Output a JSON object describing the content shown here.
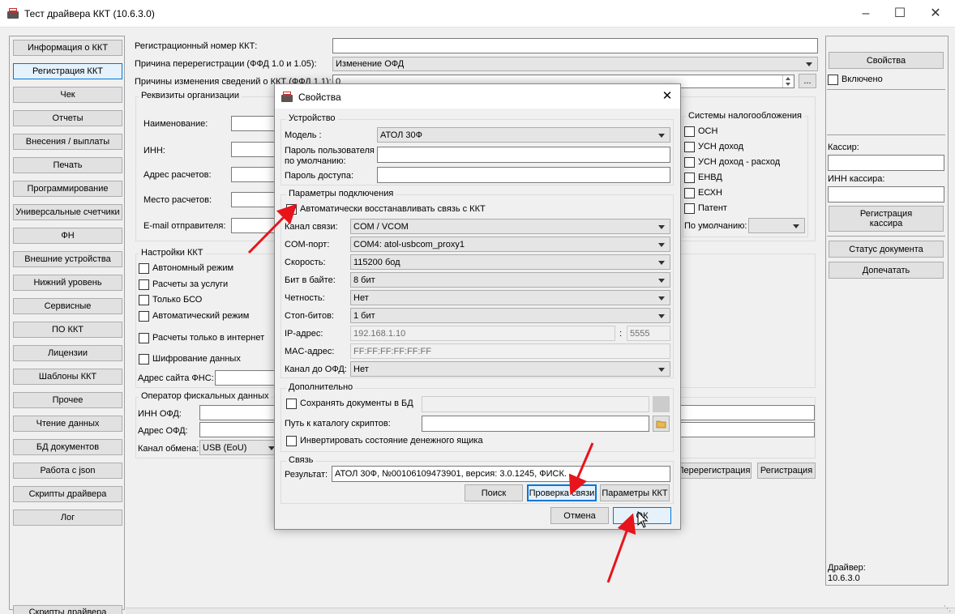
{
  "window": {
    "title": "Тест драйвера ККТ (10.6.3.0)"
  },
  "nav": {
    "items": [
      "Информация о ККТ",
      "Регистрация ККТ",
      "Чек",
      "Отчеты",
      "Внесения / выплаты",
      "Печать",
      "Программирование",
      "Универсальные счетчики",
      "ФН",
      "Внешние устройства",
      "Нижний уровень",
      "Сервисные",
      "ПО ККТ",
      "Лицензии",
      "Шаблоны ККТ",
      "Прочее",
      "Чтение данных",
      "БД документов",
      "Работа с json",
      "Скрипты драйвера",
      "Лог"
    ],
    "selected": "Регистрация ККТ",
    "hidden_item": "Скрипты драйвера"
  },
  "reg": {
    "reg_number_label": "Регистрационный номер ККТ:",
    "reason_label": "Причина перерегистрации (ФФД 1.0 и 1.05):",
    "reason_value": "Изменение ОФД",
    "changes_label": "Причины изменения сведений о ККТ (ФФД 1.1):",
    "changes_value": "0",
    "org_group": "Реквизиты организации",
    "org_name_label": "Наименование:",
    "org_inn_label": "ИНН:",
    "org_address_label": "Адрес расчетов:",
    "org_place_label": "Место расчетов:",
    "org_email_label": "E-mail отправителя:",
    "tax_group": "Системы налогообложения",
    "tax_items": [
      "ОСН",
      "УСН доход",
      "УСН доход - расход",
      "ЕНВД",
      "ЕСХН",
      "Патент"
    ],
    "tax_default_label": "По умолчанию:",
    "settings_group": "Настройки ККТ",
    "settings_items": [
      "Автономный режим",
      "Расчеты за услуги",
      "Только БСО",
      "Автоматический режим",
      "Расчеты только в интернет",
      "Шифрование данных"
    ],
    "fns_site_label": "Адрес сайта ФНС:",
    "ofd_group": "Оператор фискальных данных",
    "ofd_inn_label": "ИНН ОФД:",
    "ofd_address_label": "Адрес ОФД:",
    "exchange_label": "Канал обмена:",
    "exchange_value": "USB (EoU)",
    "rereg_button": "Перерегистрация",
    "register_button": "Регистрация"
  },
  "right": {
    "properties_button": "Свойства",
    "enabled_label": "Включено",
    "cashier_label": "Кассир:",
    "cashier_inn_label": "ИНН кассира:",
    "register_cashier_button_1": "Регистрация",
    "register_cashier_button_2": "кассира",
    "doc_status_button": "Статус документа",
    "reprint_button": "Допечатать",
    "driver_label": "Драйвер:",
    "driver_version": "10.6.3.0"
  },
  "dialog": {
    "title": "Свойства",
    "device_group": "Устройство",
    "model_label": "Модель :",
    "model_value": "АТОЛ 30Ф",
    "user_pass_label_1": "Пароль пользователя",
    "user_pass_label_2": "по умолчанию:",
    "access_pass_label": "Пароль доступа:",
    "conn_group": "Параметры подключения",
    "auto_reconnect_label": "Автоматически восстанавливать связь с ККТ",
    "channel_label": "Канал связи:",
    "channel_value": "COM / VCOM",
    "com_label": "COM-порт:",
    "com_value": "COM4: atol-usbcom_proxy1",
    "speed_label": "Скорость:",
    "speed_value": "115200 бод",
    "bits_label": "Бит в байте:",
    "bits_value": "8 бит",
    "parity_label": "Четность:",
    "parity_value": "Нет",
    "stop_label": "Стоп-битов:",
    "stop_value": "1 бит",
    "ip_label": "IP-адрес:",
    "ip_value": "192.168.1.10",
    "port_sep": ":",
    "port_value": "5555",
    "mac_label": "MAC-адрес:",
    "mac_value": "FF:FF:FF:FF:FF:FF",
    "ofd_channel_label": "Канал до ОФД:",
    "ofd_channel_value": "Нет",
    "extra_group": "Дополнительно",
    "save_docs_label": "Сохранять документы в БД",
    "scripts_path_label": "Путь к каталогу скриптов:",
    "invert_drawer_label": "Инвертировать состояние денежного ящика",
    "link_group": "Связь",
    "result_label": "Результат:",
    "result_value": "АТОЛ 30Ф, №00106109473901, версия: 3.0.1245, ФИСК.",
    "search_button": "Поиск",
    "check_button": "Проверка связи",
    "kkt_params_button": "Параметры ККТ",
    "cancel_button": "Отмена",
    "ok_button": "ОК"
  },
  "colors": {
    "arrow": "#e8141b",
    "focus": "#0078d7"
  }
}
